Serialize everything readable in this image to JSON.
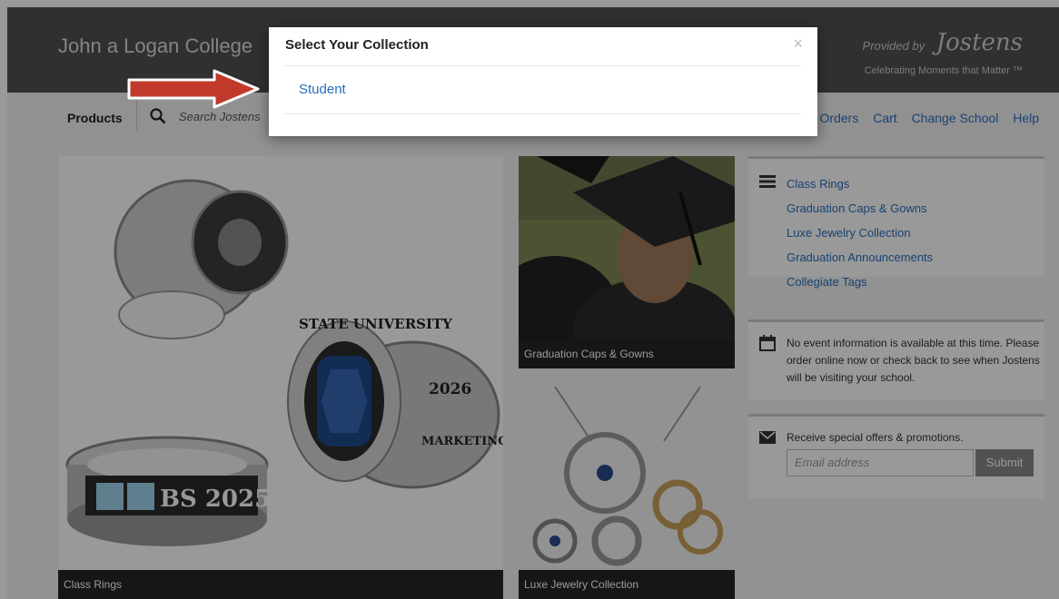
{
  "header": {
    "school_name": "John a Logan College",
    "provided_by": "Provided by",
    "brand": "Jostens",
    "tagline": "Celebrating Moments that Matter ™"
  },
  "nav": {
    "products_label": "Products",
    "search_placeholder": "Search Jostens",
    "links": {
      "orders": "Orders",
      "cart": "Cart",
      "change_school": "Change School",
      "help": "Help"
    }
  },
  "tiles": {
    "rings_caption": "Class Rings",
    "caps_caption": "Graduation Caps & Gowns",
    "luxe_caption": "Luxe Jewelry Collection",
    "ring_text": {
      "state_university": "STATE UNIVERSITY",
      "year": "2026",
      "marketing": "MARKETING",
      "band": "BS 2025"
    }
  },
  "sidebar": {
    "categories": [
      {
        "label": "Class Rings"
      },
      {
        "label": "Graduation Caps & Gowns"
      },
      {
        "label": "Luxe Jewelry Collection"
      },
      {
        "label": "Graduation Announcements"
      },
      {
        "label": "Collegiate Tags"
      }
    ],
    "event_text": "No event information is available at this time. Please order online now or check back to see when Jostens will be visiting your school.",
    "offers_text": "Receive special offers & promotions.",
    "email_placeholder": "Email address",
    "submit_label": "Submit"
  },
  "modal": {
    "title": "Select Your Collection",
    "close": "×",
    "option": "Student"
  },
  "colors": {
    "link": "#2a6ebd",
    "header_bg": "#505050",
    "arrow": "#c0392b"
  }
}
